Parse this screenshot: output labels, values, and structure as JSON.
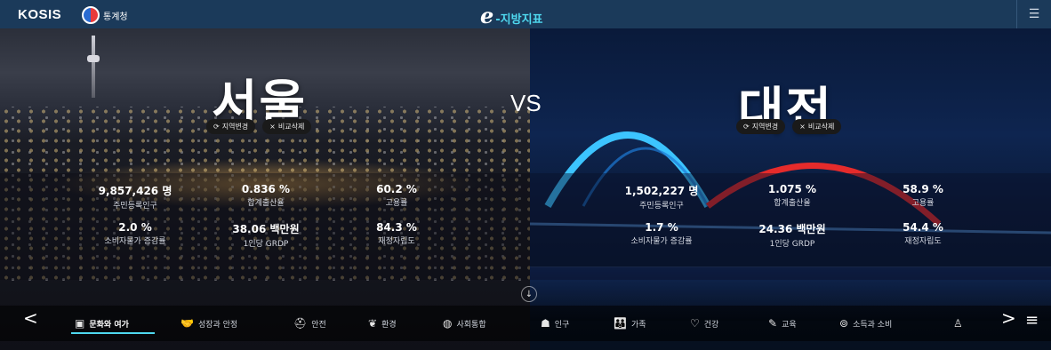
{
  "header": {
    "kosis_logo": "KOSIS",
    "stat_agency": "통계청",
    "brand_e": "e",
    "brand_title": "-지방지표",
    "menu_icon": "hamburger-icon"
  },
  "comparison": {
    "vs_label": "VS",
    "left": {
      "city": "서울",
      "change_region": "지역변경",
      "remove_compare": "비교삭제",
      "stats": [
        {
          "value": "9,857,426 명",
          "label": "주민등록인구"
        },
        {
          "value": "0.836 %",
          "label": "합계출산율"
        },
        {
          "value": "60.2 %",
          "label": "고용률"
        },
        {
          "value": "2.0 %",
          "label": "소비자물가 증감률"
        },
        {
          "value": "38.06 백만원",
          "label": "1인당 GRDP"
        },
        {
          "value": "84.3 %",
          "label": "재정자립도"
        }
      ]
    },
    "right": {
      "city": "대전",
      "change_region": "지역변경",
      "remove_compare": "비교삭제",
      "stats": [
        {
          "value": "1,502,227 명",
          "label": "주민등록인구"
        },
        {
          "value": "1.075 %",
          "label": "합계출산율"
        },
        {
          "value": "58.9 %",
          "label": "고용률"
        },
        {
          "value": "1.7 %",
          "label": "소비자물가 증감률"
        },
        {
          "value": "24.36 백만원",
          "label": "1인당 GRDP"
        },
        {
          "value": "54.4 %",
          "label": "재정자립도"
        }
      ]
    }
  },
  "bottom_nav": {
    "prev": "<",
    "next": ">",
    "menu": "≡",
    "items": [
      {
        "label": "문화와 여가",
        "icon": "monitor-icon",
        "active": true
      },
      {
        "label": "성장과 안정",
        "icon": "handshake-icon"
      },
      {
        "label": "안전",
        "icon": "helmet-icon"
      },
      {
        "label": "환경",
        "icon": "leaf-icon"
      },
      {
        "label": "사회통합",
        "icon": "globe-icon"
      },
      {
        "label": "인구",
        "icon": "people-icon"
      },
      {
        "label": "가족",
        "icon": "family-icon"
      },
      {
        "label": "건강",
        "icon": "heart-icon"
      },
      {
        "label": "교육",
        "icon": "pencil-icon"
      },
      {
        "label": "소득과 소비",
        "icon": "wallet-icon"
      },
      {
        "label": "",
        "icon": "person-icon"
      }
    ]
  },
  "colors": {
    "accent": "#4fd8ef",
    "header_bg": "#1b3a5a"
  }
}
